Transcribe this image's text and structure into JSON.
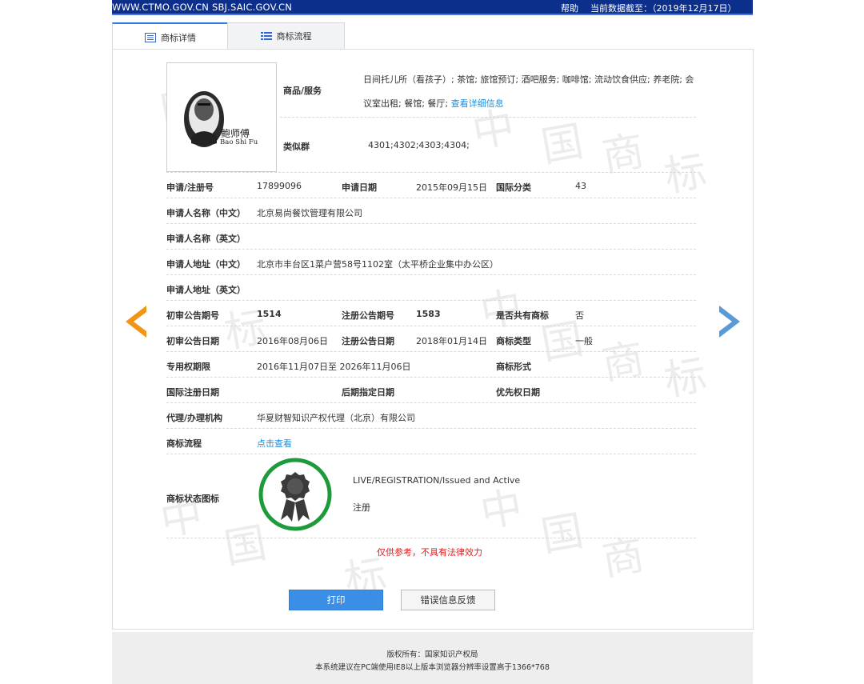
{
  "topbar": {
    "site": "WWW.CTMO.GOV.CN SBJ.SAIC.GOV.CN",
    "help": "帮助",
    "data_date": "当前数据截至：（2019年12月17日）"
  },
  "tabs": [
    {
      "label": "商标详情",
      "icon": "list-doc-icon"
    },
    {
      "label": "商标流程",
      "icon": "list-bullets-icon"
    }
  ],
  "trademark_image": {
    "chinese_text": "鲍师傅",
    "pinyin_text": "Bao Shi Fu"
  },
  "goods": {
    "label": "商品/服务",
    "line1": "日间托儿所（看孩子）; 茶馆; 旅馆预订; 酒吧服务; 咖啡馆; 流动饮食供应; 养老院; 会",
    "line2": "议室出租; 餐馆; 餐厅;",
    "detail_link": "查看详细信息"
  },
  "similar_group": {
    "label": "类似群",
    "value": "4301;4302;4303;4304;"
  },
  "fields": {
    "reg_no_label": "申请/注册号",
    "reg_no": "17899096",
    "app_date_label": "申请日期",
    "app_date": "2015年09月15日",
    "intl_class_label": "国际分类",
    "intl_class": "43",
    "applicant_cn_label": "申请人名称（中文）",
    "applicant_cn": "北京易尚餐饮管理有限公司",
    "applicant_en_label": "申请人名称（英文）",
    "address_cn_label": "申请人地址（中文）",
    "address_cn": "北京市丰台区1菜户营58号1102室（太平桥企业集中办公区）",
    "address_en_label": "申请人地址（英文）",
    "prelim_no_label": "初审公告期号",
    "prelim_no": "1514",
    "reg_pub_no_label": "注册公告期号",
    "reg_pub_no": "1583",
    "shared_label": "是否共有商标",
    "shared": "否",
    "prelim_date_label": "初审公告日期",
    "prelim_date": "2016年08月06日",
    "reg_pub_date_label": "注册公告日期",
    "reg_pub_date": "2018年01月14日",
    "tm_type_label": "商标类型",
    "tm_type": "一般",
    "exclusive_label": "专用权期限",
    "exclusive": "2016年11月07日至 2026年11月06日",
    "tm_form_label": "商标形式",
    "intl_reg_date_label": "国际注册日期",
    "later_date_label": "后期指定日期",
    "priority_label": "优先权日期",
    "agent_label": "代理/办理机构",
    "agent": "华夏财智知识产权代理（北京）有限公司",
    "flow_label": "商标流程",
    "flow_link": "点击查看",
    "status_label": "商标状态图标",
    "status_en": "LIVE/REGISTRATION/Issued and Active",
    "status_cn": "注册"
  },
  "disclaimer": "仅供参考，不具有法律效力",
  "buttons": {
    "print": "打印",
    "feedback": "错误信息反馈"
  },
  "footer": {
    "copyright": "版权所有：国家知识产权局",
    "advice": "本系统建议在PC端使用IE8以上版本浏览器分辨率设置高于1366*768"
  },
  "colors": {
    "topbar": "#0d2f8c",
    "link": "#1a8fe0",
    "prev_arrow": "#f29418",
    "next_arrow": "#5b9bd5",
    "status_ring": "#1d9a3a",
    "disclaimer": "#e02020"
  }
}
